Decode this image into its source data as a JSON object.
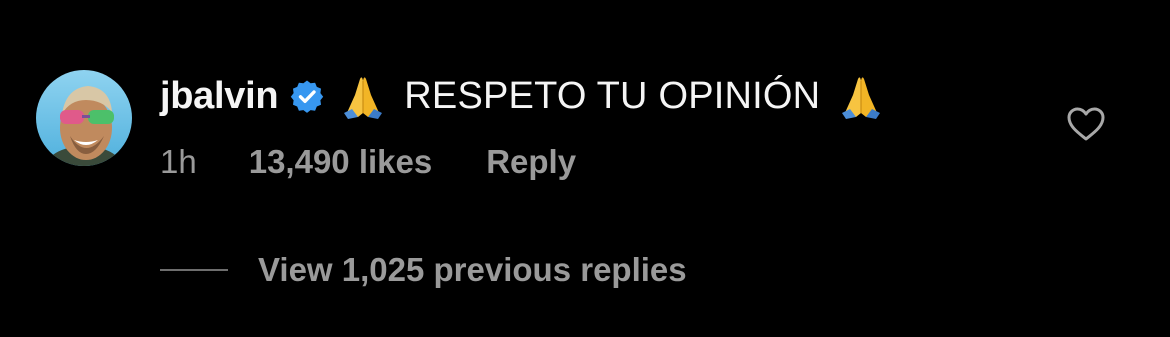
{
  "comment": {
    "username": "jbalvin",
    "text": "RESPETO TU OPINIÓN",
    "time": "1h",
    "likes": "13,490 likes",
    "reply_label": "Reply",
    "view_replies_label": "View 1,025 previous replies"
  },
  "icons": {
    "verified": "verified-badge-icon",
    "pray": "folded-hands-emoji",
    "like": "heart-outline-icon"
  },
  "colors": {
    "background": "#000000",
    "text_primary": "#f5f5f5",
    "text_secondary": "#9a9a9a",
    "verified_blue": "#3797f0"
  }
}
